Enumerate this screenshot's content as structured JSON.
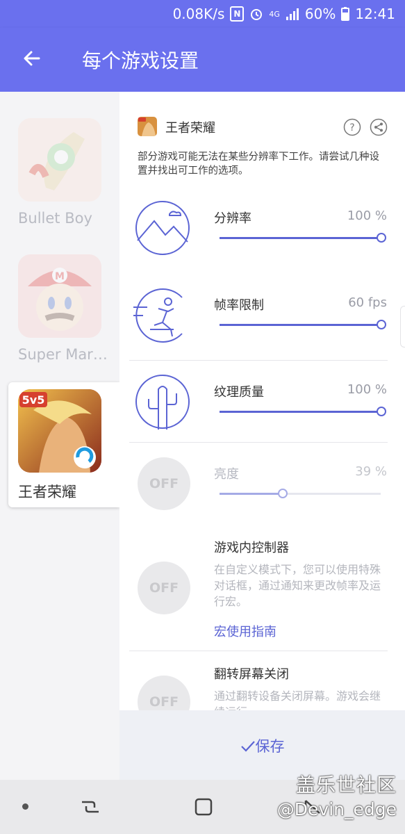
{
  "status_bar": {
    "net_speed": "0.08K/s",
    "network": "4G",
    "battery": "60%",
    "time": "12:41"
  },
  "app_bar": {
    "title": "每个游戏设置"
  },
  "sidebar": {
    "games": [
      {
        "name": "Bullet Boy",
        "active": false
      },
      {
        "name": "Super Mar…",
        "active": false
      },
      {
        "name": "王者荣耀",
        "active": true
      }
    ]
  },
  "detail": {
    "game_name": "王者荣耀",
    "description": "部分游戏可能无法在某些分辨率下工作。请尝试几种设置并找出可工作的选项。",
    "settings": [
      {
        "title": "分辨率",
        "value": "100 %",
        "level": 1.0
      },
      {
        "title": "帧率限制",
        "value": "60 fps",
        "level": 1.0
      },
      {
        "title": "纹理质量",
        "value": "100 %",
        "level": 1.0
      },
      {
        "title": "亮度",
        "value": "39 %",
        "level": 0.39,
        "toggle": "OFF"
      }
    ],
    "controller": {
      "title": "游戏内控制器",
      "toggle": "OFF",
      "description": "在自定义模式下，您可以使用特殊对话框，通过通知来更改帧率及运行宏。",
      "link": "宏使用指南"
    },
    "flip": {
      "title": "翻转屏幕关闭",
      "toggle": "OFF",
      "description": "通过翻转设备关闭屏幕。游戏会继续运行。"
    }
  },
  "save_button": {
    "label": "保存"
  },
  "watermark": {
    "line1": "盖乐世社区",
    "line2": "@Devin_edge"
  },
  "colors": {
    "accent": "#5b64d4",
    "header": "#6a70ee"
  }
}
